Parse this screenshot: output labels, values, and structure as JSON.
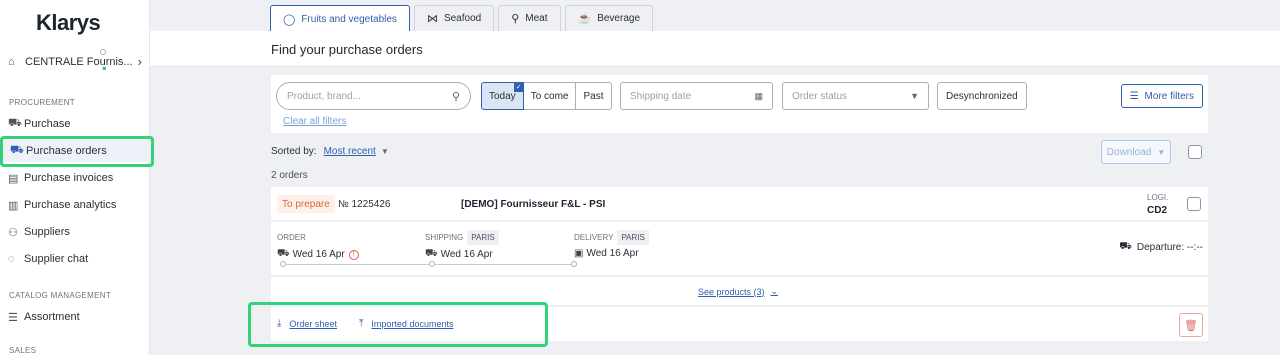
{
  "brand": {
    "name": "Klarys",
    "dot": "."
  },
  "sidebar": {
    "company": {
      "label": "CENTRALE Fournis...",
      "icon": "building-icon",
      "chevron": "›"
    },
    "sections": [
      {
        "title": "PROCUREMENT"
      },
      {
        "title": "CATALOG MANAGEMENT"
      },
      {
        "title": "SALES"
      }
    ],
    "items": [
      {
        "label": "Purchase",
        "icon": "cart-icon"
      },
      {
        "label": "Purchase orders",
        "icon": "truck-icon",
        "active": true
      },
      {
        "label": "Purchase invoices",
        "icon": "invoice-icon"
      },
      {
        "label": "Purchase analytics",
        "icon": "chart-icon"
      },
      {
        "label": "Suppliers",
        "icon": "users-icon"
      },
      {
        "label": "Supplier chat",
        "icon": "chat-icon"
      },
      {
        "label": "Assortment",
        "icon": "list-icon"
      }
    ]
  },
  "tabs": [
    {
      "label": "Fruits and vegetables",
      "icon": "apple-icon",
      "active": true
    },
    {
      "label": "Seafood",
      "icon": "fish-icon"
    },
    {
      "label": "Meat",
      "icon": "meat-icon"
    },
    {
      "label": "Beverage",
      "icon": "cup-icon"
    }
  ],
  "header": {
    "title": "Find your purchase orders"
  },
  "filters": {
    "search_placeholder": "Product, brand...",
    "segments": [
      {
        "label": "Today",
        "selected": true
      },
      {
        "label": "To come"
      },
      {
        "label": "Past"
      }
    ],
    "shipping_date_placeholder": "Shipping date",
    "order_status_placeholder": "Order status",
    "desync_label": "Desynchronized",
    "more_filters_label": "More filters",
    "clear_label": "Clear all filters"
  },
  "sort": {
    "label": "Sorted by:",
    "value": "Most recent"
  },
  "download_label": "Download",
  "orders_count": "2 orders",
  "order": {
    "status": "To prepare",
    "number": "№ 1225426",
    "supplier": "[DEMO] Fournisseur F&L - PSI",
    "logi_label": "LOGI.",
    "logi_value": "CD2",
    "order_label": "ORDER",
    "order_date": "Wed 16 Apr",
    "shipping_label": "SHIPPING",
    "shipping_tag": "PARIS",
    "shipping_date": "Wed 16 Apr",
    "delivery_label": "DELIVERY",
    "delivery_tag": "PARIS",
    "delivery_date": "Wed 16 Apr",
    "departure": "Departure: --:--",
    "see_products": "See products (3)",
    "order_sheet": "Order sheet",
    "imported_documents": "Imported documents"
  },
  "colors": {
    "accent": "#2f5fad",
    "highlight": "#34d17a",
    "status": "#e06a3a",
    "danger": "#e06a6a"
  }
}
